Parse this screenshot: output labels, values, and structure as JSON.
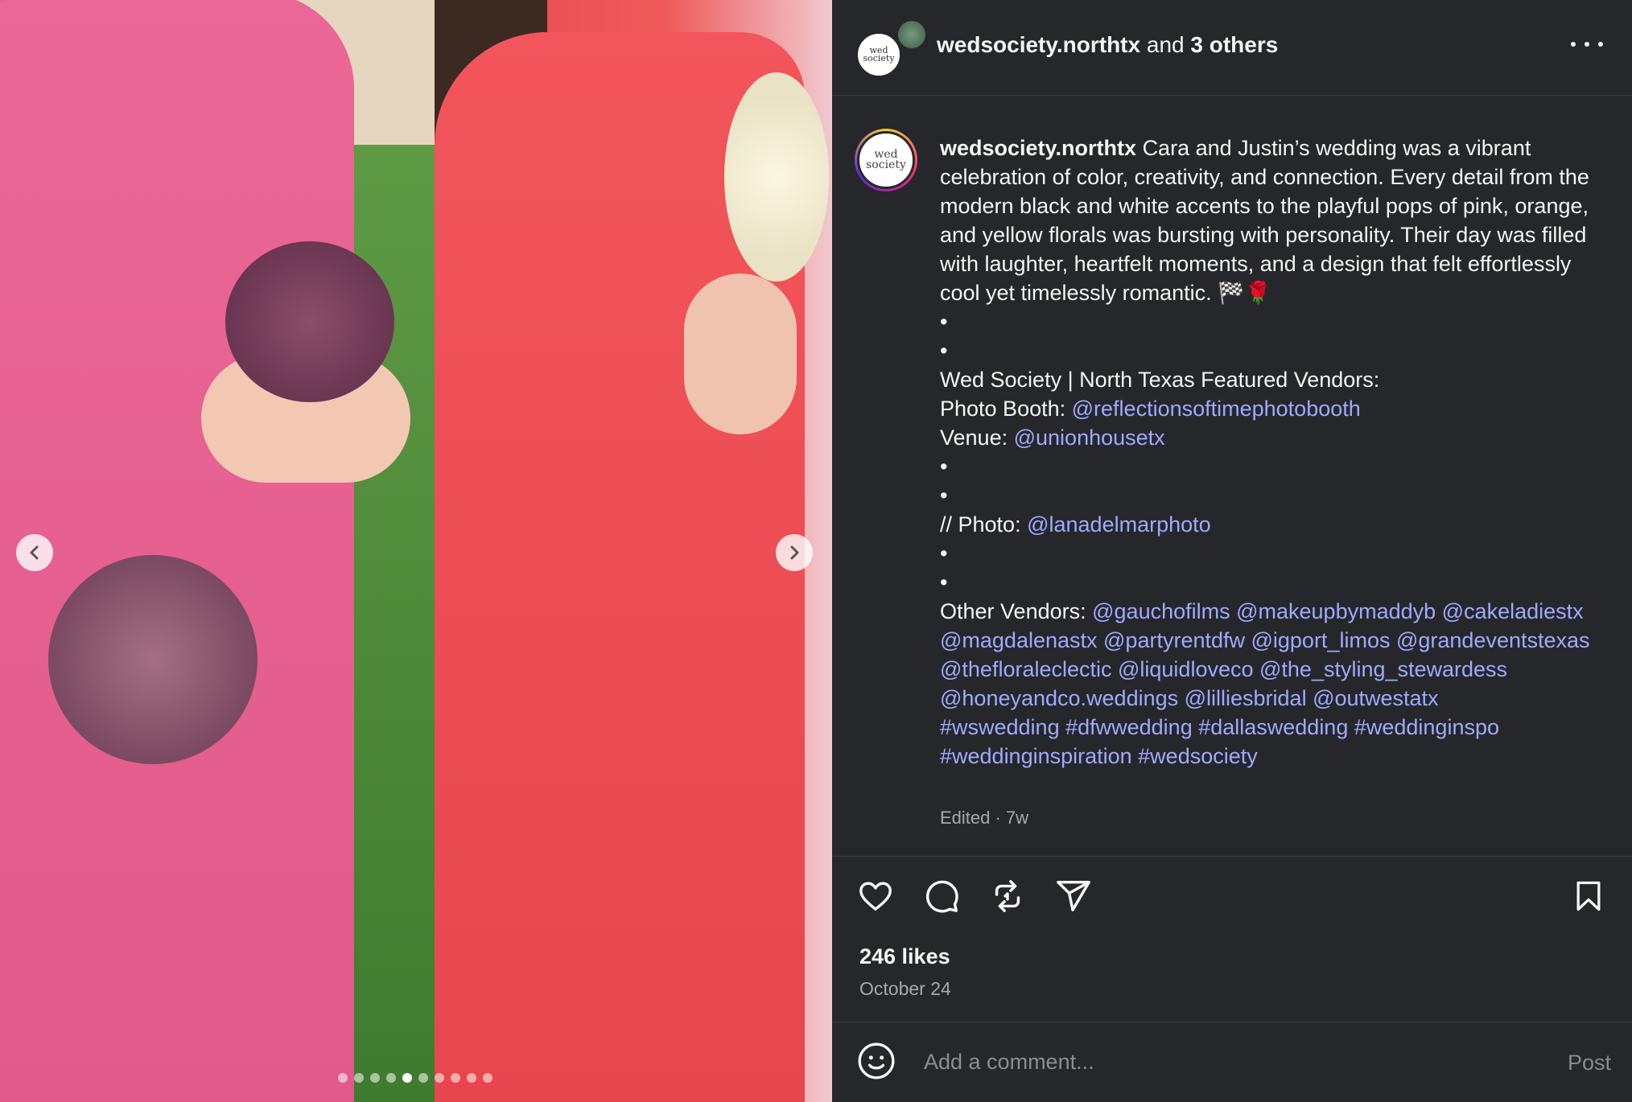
{
  "header": {
    "username": "wedsociety.northtx",
    "and_text": "and",
    "others": "3 others"
  },
  "avatar": {
    "logo_text": "wed society"
  },
  "caption": {
    "username": "wedsociety.northtx",
    "body": "Cara and Justin’s wedding was a vibrant celebration of color, creativity, and connection. Every detail from the modern black and white accents to the playful pops of pink, orange, and yellow florals was bursting with personality. Their day was filled with laughter, heartfelt moments, and a design that felt effortlessly cool yet timelessly romantic. 🏁🌹",
    "dot": "•",
    "featured_heading": "Wed Society | North Texas Featured Vendors:",
    "photo_booth_label": "Photo Booth:",
    "photo_booth_handle": "@reflectionsoftimephotobooth",
    "venue_label": "Venue:",
    "venue_handle": "@unionhousetx",
    "photo_label": "// Photo:",
    "photo_handle": "@lanadelmarphoto",
    "other_label": "Other Vendors:",
    "other_handles": "@gauchofilms @makeupbymaddyb @cakeladiestx @magdalenastx @partyrentdfw @igport_limos @grandeventstexas @thefloraleclectic @liquidloveco @the_styling_stewardess @honeyandco.weddings @lilliesbridal @outwestatx",
    "hashtags": "#wswedding #dfwwedding #dallaswedding #weddinginspo #weddinginspiration #wedsociety"
  },
  "meta": {
    "edited": "Edited · 7w"
  },
  "likes": "246 likes",
  "date": "October 24",
  "comment": {
    "placeholder": "Add a comment...",
    "post_label": "Post"
  },
  "carousel": {
    "total": 10,
    "active_index": 4
  },
  "colors": {
    "link": "#a0aaff",
    "panel_bg": "#26272b",
    "text": "#f5f5f5",
    "muted": "#a8a8a8"
  },
  "icons": [
    "chevron-left-icon",
    "chevron-right-icon",
    "more-icon",
    "heart-icon",
    "comment-icon",
    "repost-icon",
    "share-icon",
    "bookmark-icon",
    "emoji-icon"
  ]
}
